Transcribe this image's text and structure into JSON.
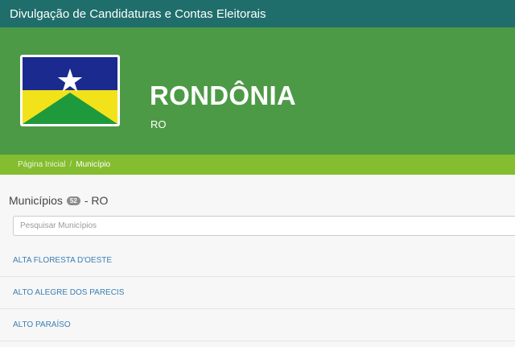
{
  "header": {
    "title": "Divulgação de Candidaturas e Contas Eleitorais"
  },
  "state": {
    "name": "RONDÔNIA",
    "code": "RO",
    "flag_icon": "rondonia-flag-icon"
  },
  "breadcrumb": {
    "home": "Página Inicial",
    "separator": "/",
    "current": "Município"
  },
  "municipios": {
    "title": "Municípios",
    "count": "52",
    "suffix": "- RO",
    "search_placeholder": "Pesquisar Municípios",
    "items": [
      "ALTA FLORESTA D'OESTE",
      "ALTO ALEGRE DOS PARECIS",
      "ALTO PARAÍSO"
    ]
  },
  "colors": {
    "topbar": "#1f6e6b",
    "hero": "#4d9a46",
    "breadcrumb": "#84bd2f",
    "link": "#3a7fb5"
  }
}
